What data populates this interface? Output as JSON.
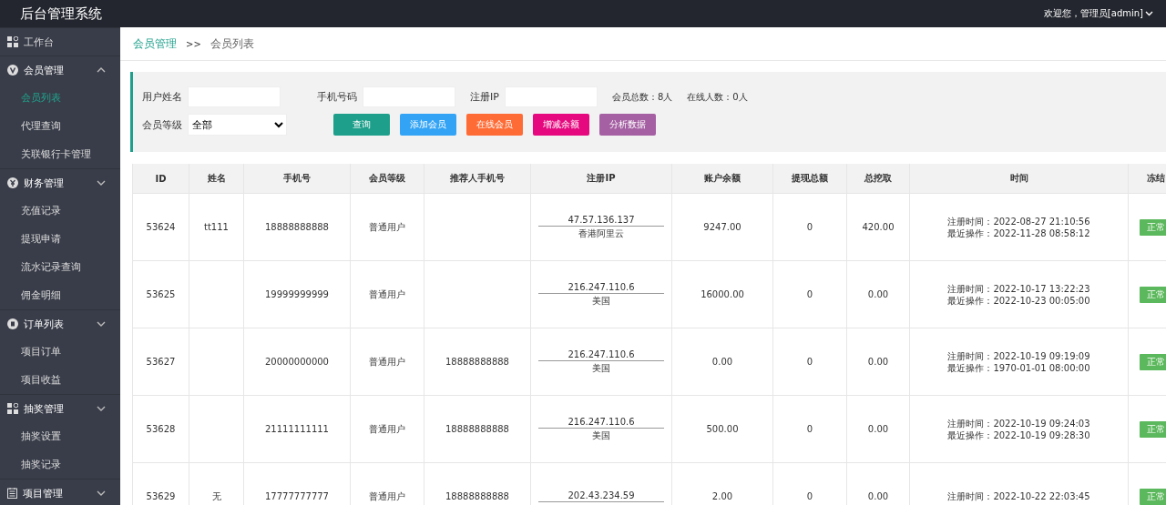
{
  "header": {
    "title": "后台管理系统",
    "user": "欢迎您，管理员[admin]"
  },
  "sidebar": {
    "items": [
      {
        "label": "工作台",
        "kind": "link"
      },
      {
        "label": "会员管理",
        "kind": "group",
        "expanded": true,
        "children": [
          {
            "label": "会员列表",
            "selected": true
          },
          {
            "label": "代理查询",
            "selected": false
          },
          {
            "label": "关联银行卡管理",
            "selected": false
          }
        ]
      },
      {
        "label": "财务管理",
        "kind": "group",
        "expanded": false,
        "children": [
          {
            "label": "充值记录",
            "selected": false
          },
          {
            "label": "提现申请",
            "selected": false
          },
          {
            "label": "流水记录查询",
            "selected": false
          },
          {
            "label": "佣金明细",
            "selected": false
          }
        ]
      },
      {
        "label": "订单列表",
        "kind": "group",
        "expanded": false,
        "children": [
          {
            "label": "项目订单",
            "selected": false
          },
          {
            "label": "项目收益",
            "selected": false
          }
        ]
      },
      {
        "label": "抽奖管理",
        "kind": "group",
        "expanded": false,
        "children": [
          {
            "label": "抽奖设置",
            "selected": false
          },
          {
            "label": "抽奖记录",
            "selected": false
          }
        ]
      },
      {
        "label": "项目管理",
        "kind": "group",
        "expanded": false
      }
    ]
  },
  "breadcrumb": {
    "parent": "会员管理",
    "separator": ">>",
    "current": "会员列表"
  },
  "filters": {
    "name_label": "用户姓名",
    "phone_label": "手机号码",
    "ip_label": "注册IP",
    "total": "会员总数：8人",
    "online": "在线人数：0人",
    "level_label": "会员等级",
    "level_value": "全部",
    "buttons": [
      {
        "label": "查询",
        "color": "#1e9f8b"
      },
      {
        "label": "添加会员",
        "color": "#33a4f5"
      },
      {
        "label": "在线会员",
        "color": "#ff6b35"
      },
      {
        "label": "增减余额",
        "color": "#e5087e"
      },
      {
        "label": "分析数据",
        "color": "#a560a3"
      }
    ]
  },
  "table": {
    "columns": [
      "ID",
      "姓名",
      "手机号",
      "会员等级",
      "推荐人手机号",
      "注册IP",
      "账户余额",
      "提现总额",
      "总挖取",
      "时间",
      "冻结"
    ],
    "rows": [
      {
        "id": "53624",
        "name": "tt111",
        "phone": "18888888888",
        "level": "普通用户",
        "referrer": "",
        "ip": "47.57.136.137",
        "region": "香港阿里云",
        "balance": "9247.00",
        "withdrawn": "0",
        "mined": "420.00",
        "reg_time": "注册时间：2022-08-27 21:10:56",
        "last_op": "最近操作：2022-11-28 08:58:12",
        "status": "正常"
      },
      {
        "id": "53625",
        "name": "",
        "phone": "19999999999",
        "level": "普通用户",
        "referrer": "",
        "ip": "216.247.110.6",
        "region": "美国",
        "balance": "16000.00",
        "withdrawn": "0",
        "mined": "0.00",
        "reg_time": "注册时间：2022-10-17 13:22:23",
        "last_op": "最近操作：2022-10-23 00:05:00",
        "status": "正常"
      },
      {
        "id": "53627",
        "name": "",
        "phone": "20000000000",
        "level": "普通用户",
        "referrer": "18888888888",
        "ip": "216.247.110.6",
        "region": "美国",
        "balance": "0.00",
        "withdrawn": "0",
        "mined": "0.00",
        "reg_time": "注册时间：2022-10-19 09:19:09",
        "last_op": "最近操作：1970-01-01 08:00:00",
        "status": "正常"
      },
      {
        "id": "53628",
        "name": "",
        "phone": "21111111111",
        "level": "普通用户",
        "referrer": "18888888888",
        "ip": "216.247.110.6",
        "region": "美国",
        "balance": "500.00",
        "withdrawn": "0",
        "mined": "0.00",
        "reg_time": "注册时间：2022-10-19 09:24:03",
        "last_op": "最近操作：2022-10-19 09:28:30",
        "status": "正常"
      },
      {
        "id": "53629",
        "name": "无",
        "phone": "17777777777",
        "level": "普通用户",
        "referrer": "18888888888",
        "ip": "202.43.234.59",
        "region": "",
        "balance": "2.00",
        "withdrawn": "0",
        "mined": "0.00",
        "reg_time": "注册时间：2022-10-22 22:03:45",
        "last_op": "",
        "status": "正常"
      }
    ]
  }
}
